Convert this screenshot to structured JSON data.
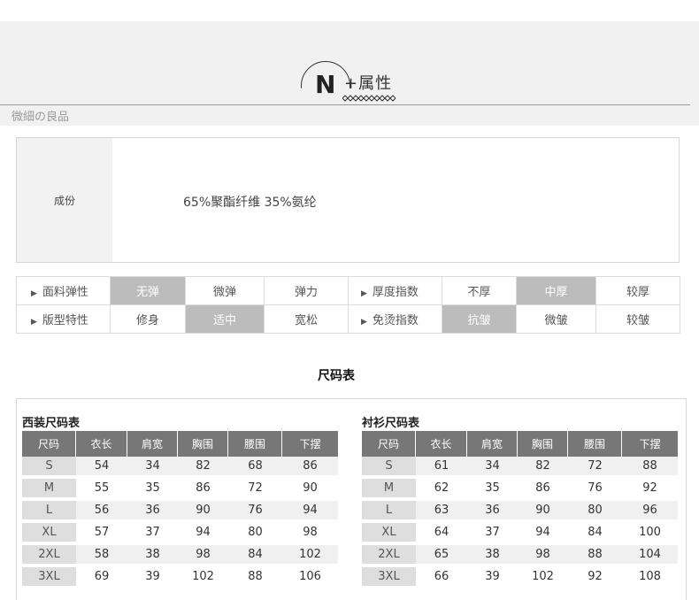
{
  "header": {
    "letter": "N",
    "title": "+属性",
    "brand": "微細の良品"
  },
  "composition": {
    "label": "成份",
    "value": "65%聚酯纤维  35%氨纶"
  },
  "properties": {
    "rows": [
      {
        "left_label": "面料弹性",
        "left_options": [
          {
            "text": "无弹",
            "selected": true
          },
          {
            "text": "微弹",
            "selected": false
          },
          {
            "text": "弹力",
            "selected": false
          }
        ],
        "right_label": "厚度指数",
        "right_options": [
          {
            "text": "不厚",
            "selected": false
          },
          {
            "text": "中厚",
            "selected": true
          },
          {
            "text": "较厚",
            "selected": false
          }
        ]
      },
      {
        "left_label": "版型特性",
        "left_options": [
          {
            "text": "修身",
            "selected": false
          },
          {
            "text": "适中",
            "selected": true
          },
          {
            "text": "宽松",
            "selected": false
          }
        ],
        "right_label": "免烫指数",
        "right_options": [
          {
            "text": "抗皱",
            "selected": true
          },
          {
            "text": "微皱",
            "selected": false
          },
          {
            "text": "较皱",
            "selected": false
          }
        ]
      }
    ]
  },
  "size_chart_title": "尺码表",
  "suit_table": {
    "title": "西装尺码表",
    "headers": [
      "尺码",
      "衣长",
      "肩宽",
      "胸围",
      "腰围",
      "下摆"
    ],
    "rows": [
      [
        "S",
        "54",
        "34",
        "82",
        "68",
        "86"
      ],
      [
        "M",
        "55",
        "35",
        "86",
        "72",
        "90"
      ],
      [
        "L",
        "56",
        "36",
        "90",
        "76",
        "94"
      ],
      [
        "XL",
        "57",
        "37",
        "94",
        "80",
        "98"
      ],
      [
        "2XL",
        "58",
        "38",
        "98",
        "84",
        "102"
      ],
      [
        "3XL",
        "69",
        "39",
        "102",
        "88",
        "106"
      ]
    ]
  },
  "shirt_table": {
    "title": "衬衫尺码表",
    "headers": [
      "尺码",
      "衣长",
      "肩宽",
      "胸围",
      "腰围",
      "下摆"
    ],
    "rows": [
      [
        "S",
        "61",
        "34",
        "82",
        "72",
        "88"
      ],
      [
        "M",
        "62",
        "35",
        "86",
        "76",
        "92"
      ],
      [
        "L",
        "63",
        "36",
        "90",
        "80",
        "96"
      ],
      [
        "XL",
        "64",
        "37",
        "94",
        "84",
        "100"
      ],
      [
        "2XL",
        "65",
        "38",
        "98",
        "88",
        "104"
      ],
      [
        "3XL",
        "66",
        "39",
        "102",
        "92",
        "108"
      ]
    ]
  },
  "colors": {
    "selected_bg": "#bcbcbc",
    "header_bg": "#777777",
    "band_bg": "#f1f1f1"
  }
}
